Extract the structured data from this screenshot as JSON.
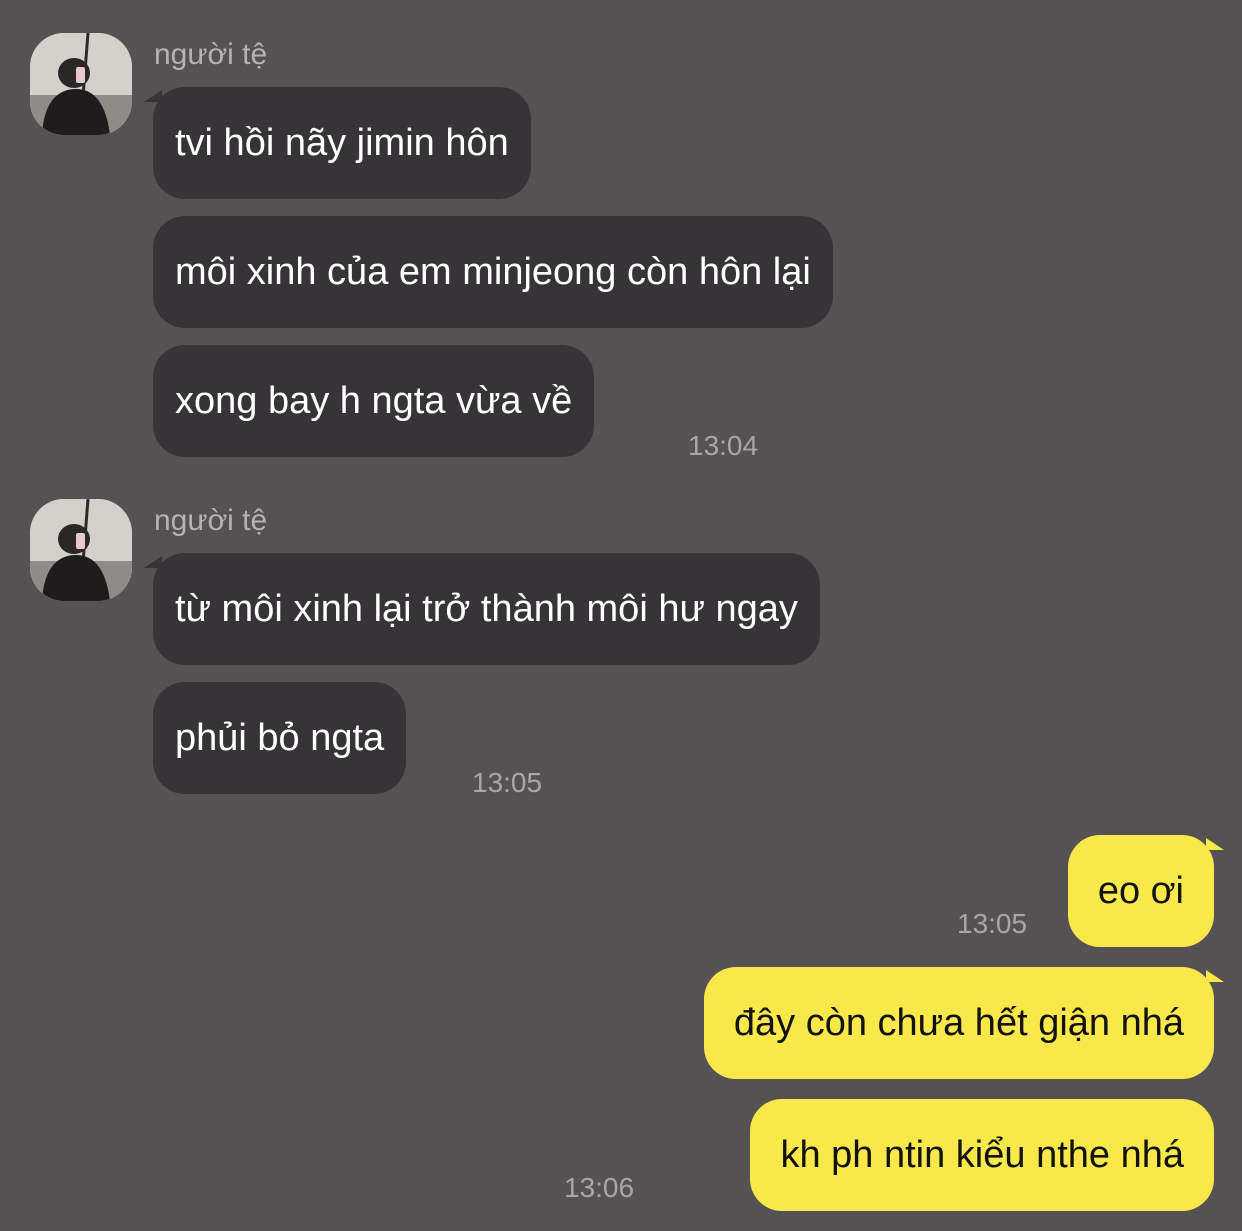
{
  "app": {
    "colors": {
      "background": "#545253",
      "incoming_bubble": "#363436",
      "outgoing_bubble": "#f9e84a",
      "meta_text": "#a8a6a7"
    }
  },
  "groups": [
    {
      "sender": "người tệ",
      "avatar": "profile-photo",
      "messages": [
        "tvi hồi nãy jimin hôn",
        "môi xinh của em minjeong còn hôn lại",
        "xong bay h ngta vừa về"
      ],
      "time": "13:04"
    },
    {
      "sender": "người tệ",
      "avatar": "profile-photo",
      "messages": [
        "từ môi xinh lại trở thành môi hư ngay",
        "phủi bỏ ngta"
      ],
      "time": "13:05"
    }
  ],
  "outgoing": [
    {
      "text": "eo ơi",
      "time": "13:05"
    },
    {
      "text": "đây còn chưa hết giận nhá",
      "time": ""
    },
    {
      "text": "kh ph ntin kiểu nthe nhá",
      "time": "13:06"
    }
  ]
}
